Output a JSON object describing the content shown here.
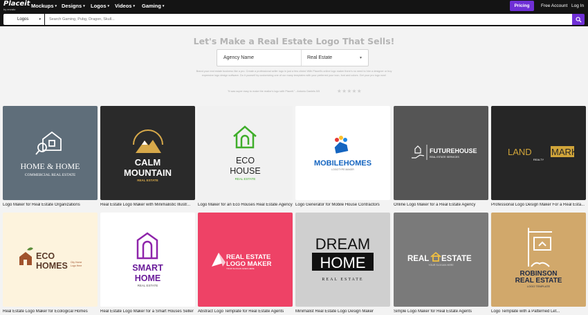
{
  "brand": {
    "name": "Placeit",
    "sub": "by envato"
  },
  "nav": {
    "items": [
      "Mockups",
      "Designs",
      "Logos",
      "Videos",
      "Gaming"
    ],
    "pricing": "Pricing",
    "free_account": "Free Account",
    "login": "Log In"
  },
  "search": {
    "category": "Logos",
    "placeholder": "Search Gaming, Pubg, Dragon, Skull..."
  },
  "hero": {
    "title": "Let's Make a Real Estate Logo That Sells!",
    "agency_field": "Agency Name",
    "industry_field": "Real Estate",
    "description": "Brand your real estate business like a pro. Create a professional seller logo in just a few clicks! With Placeit's online logo maker there's no need to hire a designer or buy expensive logo design software. Do it yourself by customizing one of our many templates with your preferred your icon, font and colors. Get your pro logo now!",
    "testimonial": "\"It was super easy to make the realtor's logo with Placeit.\" - Antonio Daniels 5/5",
    "stars": "★★★★★"
  },
  "colors": {
    "accent": "#6f2fd6",
    "nav_bg": "#141414",
    "hero_bg": "#f3f3f3"
  },
  "cards": [
    {
      "caption": "Logo Maker for Real Estate Organizations",
      "bg": "#5f6e7a",
      "line1": "HOME & HOME",
      "line2": "COMMERCIAL REAL ESTATE",
      "icon": "house-magnifier-icon"
    },
    {
      "caption": "Real Estate Logo Maker with Minimalistic Illustr...",
      "bg": "#2a2a2a",
      "line1": "CALM",
      "line2": "MOUNTAIN",
      "line3": "REAL ESTATE",
      "icon": "mountain-sun-icon"
    },
    {
      "caption": "Logo Maker for an Eco Houses Real Estate Agency",
      "bg": "#f1f1f1",
      "line1": "ECO",
      "line2": "HOUSE",
      "line3": "REAL ESTATE",
      "icon": "green-house-outline-icon"
    },
    {
      "caption": "Logo Generator for Mobile House Contractors",
      "bg": "#ffffff",
      "line1": "MOBILEHOMES",
      "line2": "LOGOTYPE MAKER",
      "icon": "house-balloons-icon"
    },
    {
      "caption": "Online Logo Maker for a Real Estate Agency",
      "bg": "#555555",
      "line1": "FUTUREHOUSE",
      "line2": "REAL ESTATE SERVICES",
      "icon": "hand-house-icon"
    },
    {
      "caption": "Professional Logo Design Maker For a Real Esta...",
      "bg": "#262626",
      "line1": "LAND",
      "line1b": "MARK",
      "line2": "REALTY",
      "icon": "gold-bar-icon"
    },
    {
      "caption": "Real Estate Logo Maker for Ecological Homes",
      "bg": "#fdf3dd",
      "line1": "ECO",
      "line2": "HOMES",
      "line3": "City Home",
      "line4": "Logo Here",
      "icon": "eco-house-icon"
    },
    {
      "caption": "Real Estate Logo Maker for a Smart Houses Seller",
      "bg": "#ffffff",
      "line1": "SMART",
      "line2": "HOME",
      "line3": "REAL ESTATE",
      "icon": "shield-arch-icon"
    },
    {
      "caption": "Abstract Logo Template for Real Estate Agents",
      "bg": "#ee4266",
      "line1": "REAL ESTATE",
      "line2": "LOGO MAKER",
      "line3": "YOUR SLOGAN GOES HERE",
      "icon": "abstract-shape-icon"
    },
    {
      "caption": "Minimalist Real Estate Logo Design Maker",
      "bg": "#cfcfcf",
      "line1": "DREAM",
      "line2": "HOME",
      "line3": "REAL ESTATE",
      "icon": ""
    },
    {
      "caption": "Simple Logo Maker for Real Estate Agents",
      "bg": "#7a7a7a",
      "line1": "REAL",
      "line1b": "ESTATE",
      "line2": "YOUR SLOGAN HERE",
      "icon": "roof-house-icon"
    },
    {
      "caption": "Logo Template with a Patterned Let...",
      "bg": "#d1a86b",
      "line1": "ROBINSON",
      "line2": "REAL ESTATE",
      "line3": "LOGO TEMPLATE",
      "icon": "sign-post-icon"
    }
  ]
}
